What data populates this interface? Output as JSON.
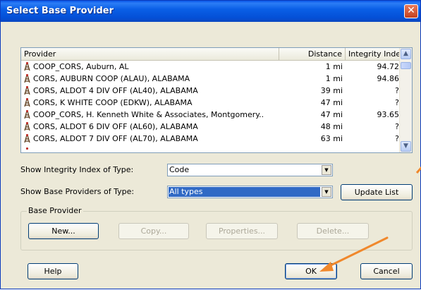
{
  "window": {
    "title": "Select Base Provider",
    "close_glyph": "✕"
  },
  "list": {
    "columns": [
      "Provider",
      "Distance",
      "Integrity Index"
    ],
    "rows": [
      {
        "provider": "COOP_CORS, Auburn, AL",
        "distance": "1 mi",
        "integrity": "94.72"
      },
      {
        "provider": "CORS, AUBURN COOP (ALAU),  ALABAMA",
        "distance": "1 mi",
        "integrity": "94.86"
      },
      {
        "provider": "CORS, ALDOT 4 DIV OFF (AL40),  ALABAMA",
        "distance": "39 mi",
        "integrity": "?"
      },
      {
        "provider": "CORS, K WHITE COOP (EDKW),  ALABAMA",
        "distance": "47 mi",
        "integrity": "?"
      },
      {
        "provider": "COOP_CORS, H. Kenneth White & Associates, Montgomery...",
        "distance": "47 mi",
        "integrity": "93.65"
      },
      {
        "provider": "CORS, ALDOT 6 DIV OFF (AL60),  ALABAMA",
        "distance": "48 mi",
        "integrity": "?"
      },
      {
        "provider": "CORS, ALDOT 7 DIV OFF (AL70),  ALABAMA",
        "distance": "63 mi",
        "integrity": "?"
      }
    ]
  },
  "integrity_type": {
    "label": "Show Integrity Index of Type:",
    "value": "Code"
  },
  "provider_type": {
    "label": "Show Base Providers of Type:",
    "value": "All types"
  },
  "update_button": "Update List",
  "base_provider": {
    "title": "Base Provider",
    "new": "New...",
    "copy": "Copy...",
    "properties": "Properties...",
    "delete": "Delete..."
  },
  "buttons": {
    "help": "Help",
    "ok": "OK",
    "cancel": "Cancel"
  },
  "icons": {
    "provider": "antenna-tower-icon",
    "scroll_up": "scroll-up-arrow-icon",
    "scroll_down": "scroll-down-arrow-icon",
    "dropdown": "dropdown-arrow-icon"
  },
  "colors": {
    "title_bar": "#0a5fe6",
    "selection": "#316ac5",
    "annotation_arrow": "#f0882c"
  }
}
